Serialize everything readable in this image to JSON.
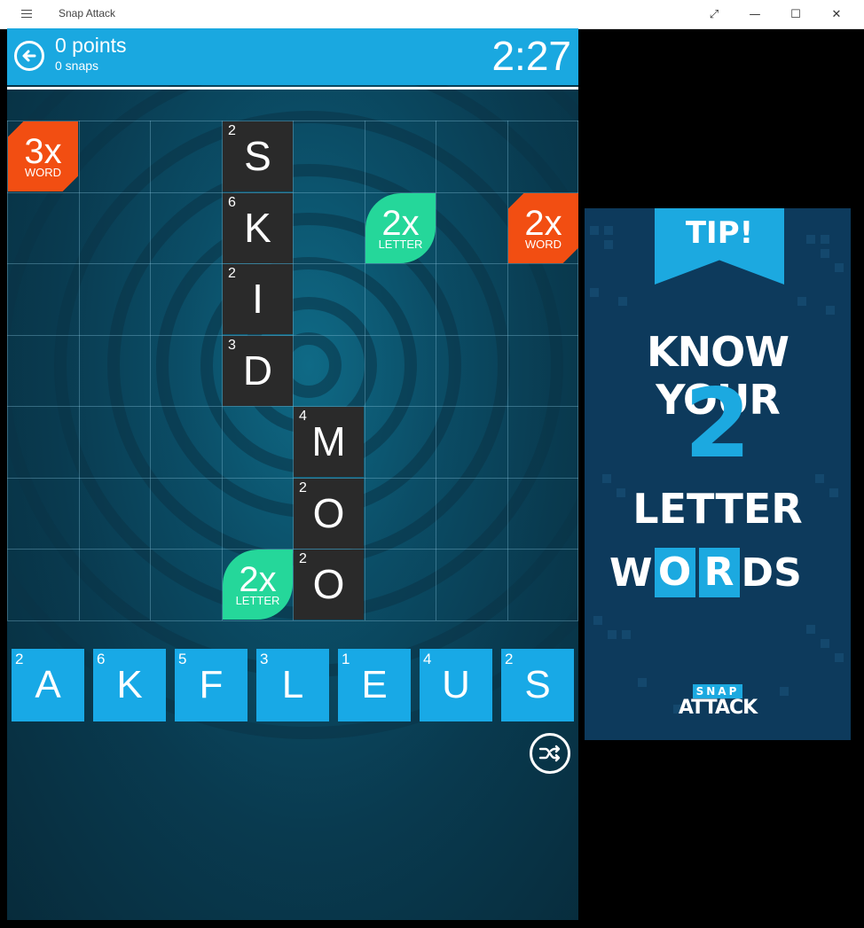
{
  "window": {
    "title": "Snap Attack",
    "buttons": {
      "restore": "⤢",
      "minimize": "—",
      "maximize": "☐",
      "close": "✕"
    }
  },
  "header": {
    "points": "0 points",
    "snaps": "0 snaps",
    "timer": "2:27"
  },
  "board": {
    "columns": 8,
    "rows": 7,
    "tiles": [
      {
        "letter": "S",
        "points": "2",
        "col": 3,
        "row": 0
      },
      {
        "letter": "K",
        "points": "6",
        "col": 3,
        "row": 1
      },
      {
        "letter": "I",
        "points": "2",
        "col": 3,
        "row": 2
      },
      {
        "letter": "D",
        "points": "3",
        "col": 3,
        "row": 3
      },
      {
        "letter": "M",
        "points": "4",
        "col": 4,
        "row": 4
      },
      {
        "letter": "O",
        "points": "2",
        "col": 4,
        "row": 5
      },
      {
        "letter": "O",
        "points": "2",
        "col": 4,
        "row": 6
      }
    ],
    "bonuses": [
      {
        "multiplier": "3x",
        "kind": "WORD",
        "col": 0,
        "row": 0
      },
      {
        "multiplier": "2x",
        "kind": "LETTER",
        "col": 5,
        "row": 1
      },
      {
        "multiplier": "2x",
        "kind": "WORD",
        "col": 7,
        "row": 1
      },
      {
        "multiplier": "2x",
        "kind": "LETTER",
        "col": 3,
        "row": 6
      }
    ]
  },
  "rack": [
    {
      "letter": "A",
      "points": "2"
    },
    {
      "letter": "K",
      "points": "6"
    },
    {
      "letter": "F",
      "points": "5"
    },
    {
      "letter": "L",
      "points": "3"
    },
    {
      "letter": "E",
      "points": "1"
    },
    {
      "letter": "U",
      "points": "4"
    },
    {
      "letter": "S",
      "points": "2"
    }
  ],
  "ad": {
    "tip": "TIP!",
    "line1": "KNOW YOUR",
    "number": "2",
    "line3": "LETTER",
    "line4_parts": [
      "W",
      "O",
      "R",
      "DS"
    ],
    "logo_top": "SNAP",
    "logo_bottom": "ATTACK"
  },
  "icons": {
    "back": "back-arrow-icon",
    "shuffle": "shuffle-icon",
    "menu": "hamburger-menu-icon"
  },
  "colors": {
    "header": "#1aa8e0",
    "tile": "#2a2a2a",
    "rack_tile": "#18a9e6",
    "word_bonus": "#f24e12",
    "letter_bonus": "#25d79a",
    "ad_bg": "#0d3a5c"
  }
}
